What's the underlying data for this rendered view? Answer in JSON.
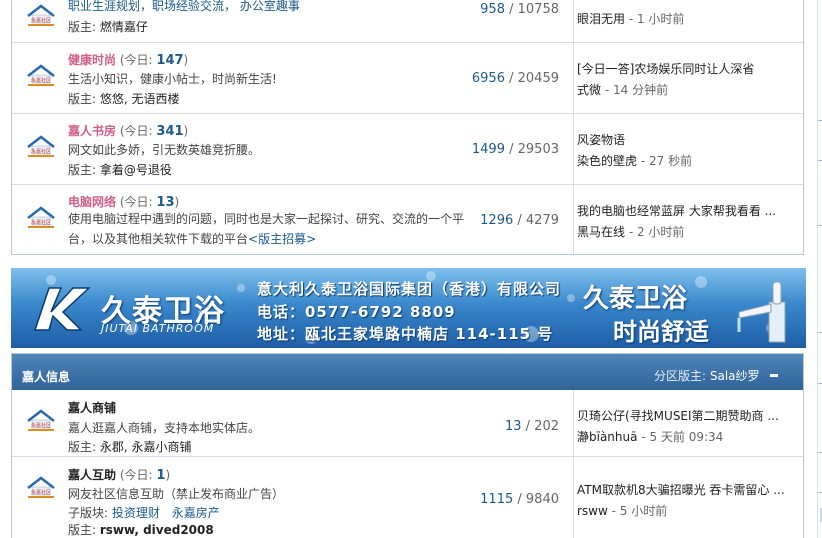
{
  "colors": {
    "link_blue": "#1a5a8c",
    "pink_title": "#d06088",
    "header_bg": "#2f639a",
    "border": "#b8c8dc"
  },
  "icon_text": "永嘉社区",
  "forums_top": [
    {
      "name": "职业生涯规划，职场经验交流， 办公室趣事",
      "moderator_label": "版主:",
      "moderators": "燃情嘉仔",
      "threads": "958",
      "posts": "10758",
      "last_title": "眼泪无用",
      "last_user": "",
      "last_time": "1 小时前"
    },
    {
      "name": "健康时尚",
      "today_prefix": "(今日:",
      "today_count": "147",
      "today_suffix": ")",
      "desc": "生活小知识，健康小帖士，时尚新生活!",
      "moderator_label": "版主:",
      "moderators": "悠悠, 无语西楼",
      "threads": "6956",
      "posts": "20459",
      "last_title": "[今日一答]农场娱乐同时让人深省",
      "last_user": "式微",
      "last_time": "14 分钟前"
    },
    {
      "name": "嘉人书房",
      "today_prefix": "(今日:",
      "today_count": "341",
      "today_suffix": ")",
      "desc": "网文如此多娇，引无数英雄竞折腰。",
      "moderator_label": "版主:",
      "moderators": "拿着@号退役",
      "threads": "1499",
      "posts": "29503",
      "last_title": "风姿物语",
      "last_user": "染色的壁虎",
      "last_time": "27 秒前"
    },
    {
      "name": "电脑网络",
      "today_prefix": "(今日:",
      "today_count": "13",
      "today_suffix": ")",
      "desc": "使用电脑过程中遇到的问题，同时也是大家一起探讨、研究、交流的一个平台，以及其他相关软件下载的平台",
      "recruit_link": "<版主招募>",
      "threads": "1296",
      "posts": "4279",
      "last_title": "我的电脑也经常蓝屏  大家帮我看看 ...",
      "last_user": "黑马在线",
      "last_time": "2 小时前"
    }
  ],
  "banner": {
    "brand": "久泰卫浴",
    "brand_en": "JIUTAI BATHROOM",
    "company": "意大利久泰卫浴国际集团（香港）有限公司",
    "phone": "电话：0577-6792 8809",
    "address": "地址：瓯北王家埠路中楠店 114-115 号",
    "brand2": "久泰卫浴",
    "slogan": "时尚舒适"
  },
  "category": {
    "title": "嘉人信息",
    "mod_label": "分区版主:",
    "mod_name": "Sala纱罗"
  },
  "forums_bottom": [
    {
      "name": "嘉人商铺",
      "desc": "嘉人逛嘉人商铺，支持本地实体店。",
      "moderator_label": "版主:",
      "moderators": "永郡, 永嘉小商铺",
      "threads": "13",
      "posts": "202",
      "last_title": "贝琦公仔(寻找MUSEI第二期赞助商 ...",
      "last_user": "瀞bīànhuā",
      "last_time": "5 天前 09:34"
    },
    {
      "name": "嘉人互助",
      "today_prefix": "(今日:",
      "today_count": "1",
      "today_suffix": ")",
      "desc": "网友社区信息互助（禁止发布商业广告）",
      "sub_label": "子版块:",
      "sub1": "投资理财",
      "sub2": "永嘉房产",
      "moderator_label": "版主:",
      "moderators": "rsww, dived2008",
      "threads": "1115",
      "posts": "9840",
      "last_title": "ATM取款机8大骗招曝光  吞卡需留心 ...",
      "last_user": "rsww",
      "last_time": "5 小时前"
    }
  ]
}
